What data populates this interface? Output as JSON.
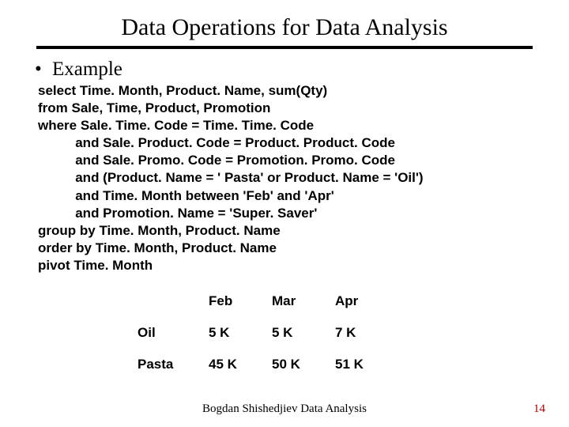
{
  "title": "Data Operations for Data Analysis",
  "bullet": {
    "marker": "•",
    "label": "Example"
  },
  "sql": {
    "l1": "select Time. Month, Product. Name, sum(Qty)",
    "l2": "from Sale, Time, Product, Promotion",
    "l3": "where Sale. Time. Code = Time. Time. Code",
    "l4": "          and Sale. Product. Code = Product. Product. Code",
    "l5": "          and Sale. Promo. Code = Promotion. Promo. Code",
    "l6": "          and (Product. Name = ' Pasta' or Product. Name = 'Oil')",
    "l7": "          and Time. Month between 'Feb' and 'Apr'",
    "l8": "          and Promotion. Name = 'Super. Saver'",
    "l9": "group by Time. Month, Product. Name",
    "l10": "order by Time. Month, Product. Name",
    "l11": "pivot Time. Month"
  },
  "chart_data": {
    "type": "table",
    "columns": [
      "Feb",
      "Mar",
      "Apr"
    ],
    "rows": [
      {
        "name": "Oil",
        "values": [
          "5 K",
          "5 K",
          "7 K"
        ]
      },
      {
        "name": "Pasta",
        "values": [
          "45 K",
          "50 K",
          "51 K"
        ]
      }
    ]
  },
  "footer": "Bogdan Shishedjiev Data Analysis",
  "page_number": "14"
}
